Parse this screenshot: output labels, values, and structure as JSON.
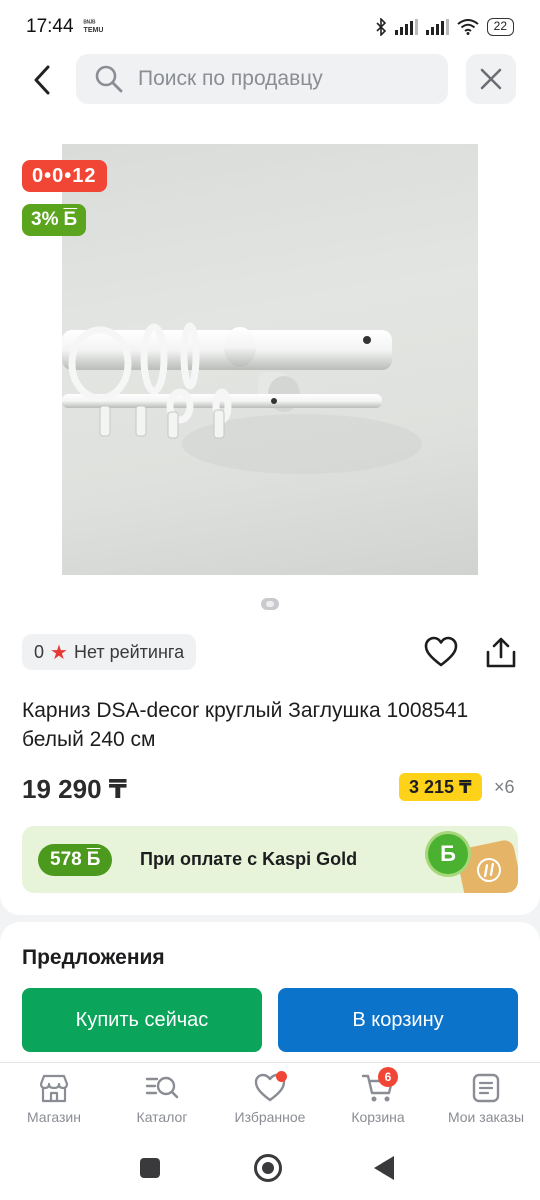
{
  "status_bar": {
    "time": "17:44",
    "mini_label_1": "ᴮᴺᴶᴮ",
    "mini_label_2": "TEMU",
    "battery": "22"
  },
  "header": {
    "search_placeholder": "Поиск по продавцу"
  },
  "product": {
    "timer_badge": "0•0•12",
    "bonus_badge": "3%",
    "bonus_glyph": "Б",
    "rating_value": "0",
    "rating_text": "Нет рейтинга",
    "title": "Карниз DSA-decor круглый Заглушка 1008541 белый 240 см",
    "price": "19 290 ₸",
    "installment": "3 215 ₸",
    "installment_months": "×6"
  },
  "kaspi_gold": {
    "bonus": "578",
    "bonus_glyph": "Б",
    "text": "При оплате с Kaspi Gold",
    "coin_glyph": "Б"
  },
  "offers": {
    "title": "Предложения",
    "buy_now": "Купить сейчас",
    "add_to_cart": "В корзину"
  },
  "bottom_nav": {
    "items": [
      {
        "label": "Магазин",
        "icon": "store-icon"
      },
      {
        "label": "Каталог",
        "icon": "catalog-search-icon"
      },
      {
        "label": "Избранное",
        "icon": "heart-icon"
      },
      {
        "label": "Корзина",
        "icon": "cart-icon",
        "badge": "6"
      },
      {
        "label": "Мои заказы",
        "icon": "orders-icon"
      }
    ]
  },
  "colors": {
    "accent_red": "#f14635",
    "green": "#0aa45a",
    "blue": "#0b73c9",
    "yellow": "#ffd21a"
  }
}
